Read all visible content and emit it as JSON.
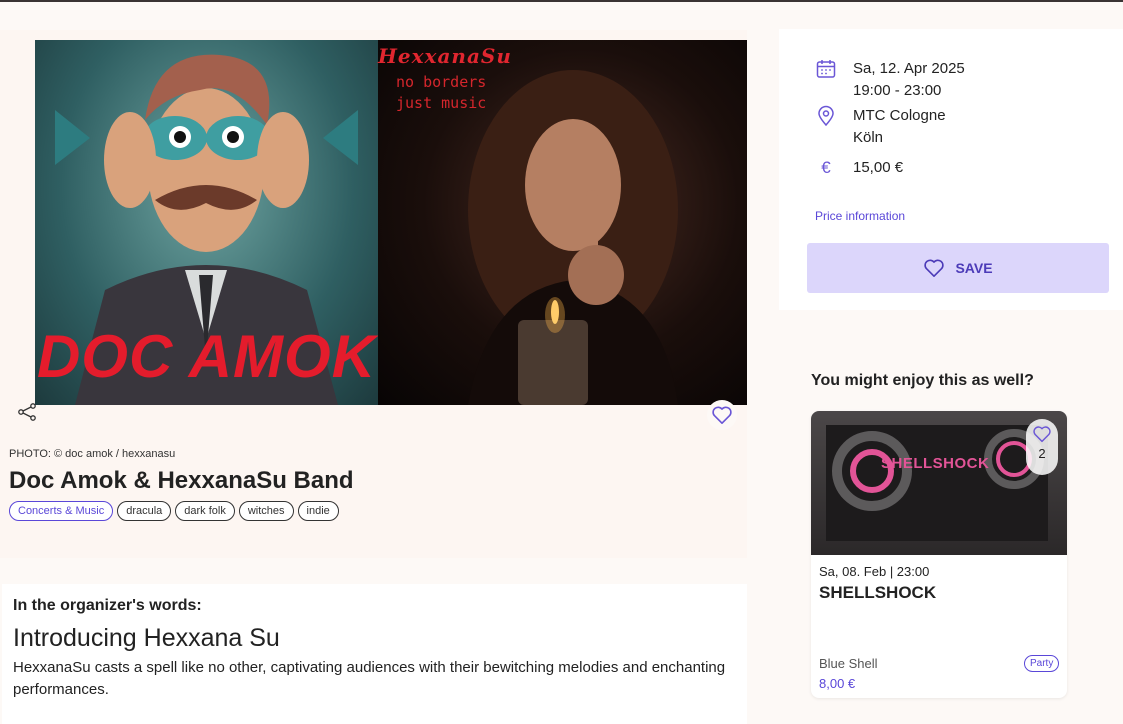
{
  "event": {
    "photo_credit": "PHOTO: © doc amok / hexxanasu",
    "title": "Doc Amok & HexxanaSu Band",
    "image_text": {
      "doc": "DOC AMOK",
      "hexx_title": "HexxanaSu",
      "hexx_sub": "no borders\njust music"
    },
    "tags": [
      {
        "label": "Concerts & Music",
        "primary": true
      },
      {
        "label": "dracula"
      },
      {
        "label": "dark folk"
      },
      {
        "label": "witches"
      },
      {
        "label": "indie"
      }
    ]
  },
  "organizer": {
    "heading": "In the organizer's words:",
    "title": "Introducing Hexxana Su",
    "body": "HexxanaSu casts a spell like no other, captivating audiences with their bewitching melodies and enchanting performances."
  },
  "info": {
    "date": "Sa, 12. Apr 2025",
    "time": "19:00 - 23:00",
    "venue": "MTC Cologne",
    "city": "Köln",
    "price": "15,00 €",
    "price_link": "Price information",
    "save_label": "SAVE",
    "icons": {
      "date": "calendar-icon",
      "location": "location-pin-icon",
      "price": "euro-icon"
    }
  },
  "recommendations": {
    "heading": "You might enjoy this as well?",
    "items": [
      {
        "image_text": "SHELLSHOCK",
        "like_count": "2",
        "date": "Sa, 08. Feb | 23:00",
        "title": "SHELLSHOCK",
        "venue": "Blue Shell",
        "price": "8,00 €",
        "category": "Party"
      }
    ]
  },
  "colors": {
    "accent": "#5a47d8",
    "save_bg": "#dcd6fb",
    "page_bg": "#fdf9f6"
  }
}
